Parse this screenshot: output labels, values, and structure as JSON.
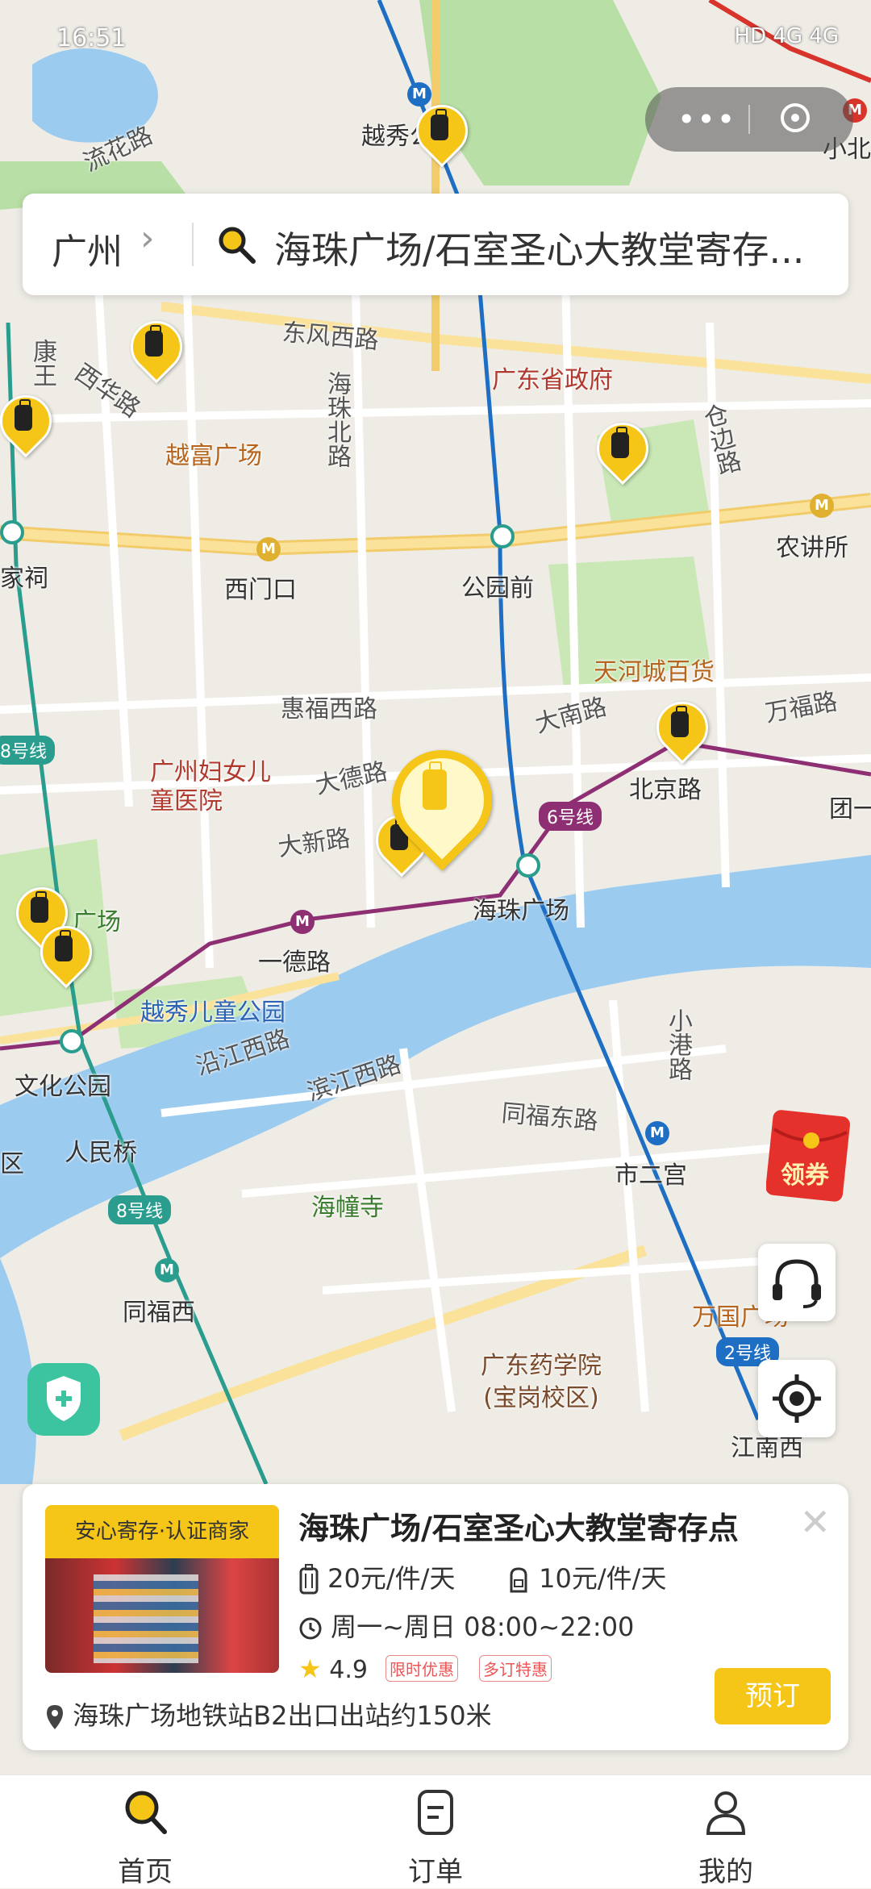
{
  "status": {
    "time": "16:51",
    "icons": "HD 4G 4G"
  },
  "search": {
    "city": "广州",
    "query": "海珠广场/石室圣心大教堂寄存..."
  },
  "map_labels": {
    "yuexiu_park": "越秀公园",
    "xiaobei": "小北",
    "liuhua": "流花路",
    "dongfeng": "东风西路",
    "gov": "广东省政府",
    "xihua": "西华路",
    "kang": "康王",
    "yuefu": "越富广场",
    "haizhubei": "海珠北路",
    "cangbian": "仓边路",
    "nongjiangsuo": "农讲所",
    "jiaci": "家祠",
    "ximenkou": "西门口",
    "gongyuanqian": "公园前",
    "tianhecheng": "天河城百货",
    "huifu": "惠福西路",
    "danan": "大南路",
    "wanfu": "万福路",
    "beijinglu": "北京路",
    "tuanyi": "团一",
    "hospital": "广州妇女儿童医院",
    "dade": "大德路",
    "daxin": "大新路",
    "line6": "6号线",
    "line8": "8号线",
    "line8b": "8号线",
    "line2": "2号线",
    "haizhuguangchang": "海珠广场",
    "guangchang": "广场",
    "yidelu": "一德路",
    "yuexiu_kids": "越秀儿童公园",
    "yanjiang": "沿江西路",
    "binjiang": "滨江西路",
    "xiaogang": "小港路",
    "wenhua": "文化公园",
    "tongfudong": "同福东路",
    "renminqiao": "人民桥",
    "shiergong": "市二宫",
    "qu": "区",
    "haichuang": "海幢寺",
    "tongfuxi": "同福西",
    "wanguo": "万国广场",
    "pharma": "广东药学院\n(宝岗校区)",
    "jiangnanxi": "江南西"
  },
  "promo": {
    "redpacket_label": "领券"
  },
  "card": {
    "badge": "安心寄存·认证商家",
    "title": "海珠广场/石室圣心大教堂寄存点",
    "price_large": "20元/件/天",
    "price_small": "10元/件/天",
    "hours": "周一~周日 08:00~22:00",
    "rating": "4.9",
    "tag1": "限时优惠",
    "tag2": "多订特惠",
    "address": "海珠广场地铁站B2出口出站约150米",
    "book_label": "预订"
  },
  "tabs": [
    {
      "label": "首页",
      "icon": "search-icon"
    },
    {
      "label": "订单",
      "icon": "order-icon"
    },
    {
      "label": "我的",
      "icon": "user-icon"
    }
  ],
  "colors": {
    "accent": "#f5c518",
    "river": "#9ccbf0",
    "park": "#b8dfa5"
  }
}
